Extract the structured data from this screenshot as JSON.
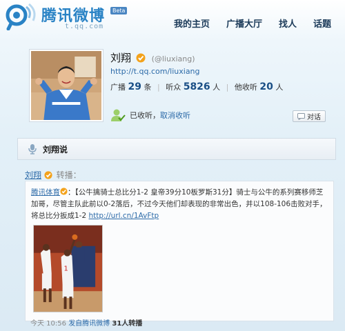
{
  "header": {
    "logo_text": "腾讯微博",
    "logo_badge": "Beta",
    "logo_domain": "t.qq.com",
    "nav": [
      "我的主页",
      "广播大厅",
      "找人",
      "话题"
    ]
  },
  "profile": {
    "name": "刘翔",
    "handle": "(@liuxiang)",
    "url": "http://t.qq.com/liuxiang",
    "stats": {
      "broadcast_label": "广播",
      "broadcast_count": "29",
      "broadcast_unit": "条",
      "listeners_label": "听众",
      "listeners_count": "5826",
      "listeners_unit": "人",
      "listening_label": "他收听",
      "listening_count": "20",
      "listening_unit": "人"
    },
    "follow_status": "已收听",
    "unfollow_link": "取消收听",
    "dialog_button": "对话"
  },
  "section": {
    "title": "刘翔说"
  },
  "post": {
    "author": "刘翔",
    "action": "转播：",
    "source": "腾讯体育",
    "text": "：【公牛擒骑士总比分1-2 皇帝39分10板罗斯31分】骑士与公牛的系列赛移师芝加哥，尽管主队此前以0-2落后，不过今天他们却表现的非常出色，并以108-106击败对手，将总比分扳成1-2",
    "link": "http://url.cn/1AvFtp",
    "meta_time": "今天 10:56",
    "meta_from": "发自腾讯微博",
    "meta_count": "31人转播"
  },
  "colors": {
    "brand": "#2a83c5",
    "link": "#2c6aa8",
    "nav": "#1b3a59"
  }
}
